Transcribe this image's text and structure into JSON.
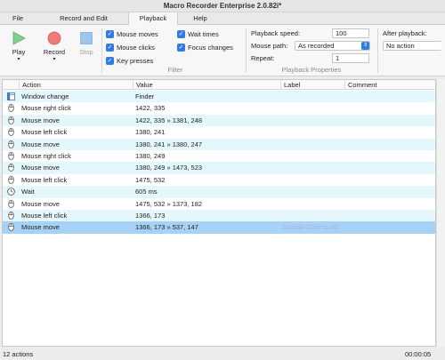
{
  "window": {
    "title": "Macro Recorder Enterprise 2.0.82i*"
  },
  "menu": [
    "File",
    "Record and Edit",
    "Playback",
    "Help"
  ],
  "ribbon": {
    "play": {
      "label": "Play",
      "icon": "play-icon"
    },
    "record": {
      "label": "Record",
      "icon": "record-icon"
    },
    "stop": {
      "label": "Stop",
      "icon": "stop-icon"
    },
    "filter": {
      "group_label": "Filter",
      "mouse_moves": "Mouse moves",
      "mouse_clicks": "Mouse clicks",
      "key_presses": "Key presses",
      "wait_times": "Wait times",
      "focus_changes": "Focus changes"
    },
    "playback_properties": {
      "group_label": "Playback Properties",
      "speed_label": "Playback speed:",
      "speed_value": "100",
      "path_label": "Mouse path:",
      "path_value": "As recorded",
      "repeat_label": "Repeat:",
      "repeat_value": "1"
    },
    "after_playback": {
      "label": "After playback:",
      "value": "No action"
    }
  },
  "table": {
    "columns": [
      "Action",
      "Value",
      "Label",
      "Comment"
    ],
    "rows": [
      {
        "icon": "window-icon",
        "action": "Window change",
        "value": "Finder",
        "label": "",
        "comment": ""
      },
      {
        "icon": "mouse-icon",
        "action": "Mouse right click",
        "value": "1422, 335",
        "label": "",
        "comment": ""
      },
      {
        "icon": "mouse-icon",
        "action": "Mouse move",
        "value": "1422, 335 » 1381, 248",
        "label": "",
        "comment": ""
      },
      {
        "icon": "mouse-icon",
        "action": "Mouse left click",
        "value": "1380, 241",
        "label": "",
        "comment": ""
      },
      {
        "icon": "mouse-icon",
        "action": "Mouse move",
        "value": "1380, 241 » 1380, 247",
        "label": "",
        "comment": ""
      },
      {
        "icon": "mouse-icon",
        "action": "Mouse right click",
        "value": "1380, 249",
        "label": "",
        "comment": ""
      },
      {
        "icon": "mouse-icon",
        "action": "Mouse move",
        "value": "1380, 249 » 1473, 523",
        "label": "",
        "comment": ""
      },
      {
        "icon": "mouse-icon",
        "action": "Mouse left click",
        "value": "1475, 532",
        "label": "",
        "comment": ""
      },
      {
        "icon": "clock-icon",
        "action": "Wait",
        "value": "605 ms",
        "label": "",
        "comment": ""
      },
      {
        "icon": "mouse-icon",
        "action": "Mouse move",
        "value": "1475, 532 » 1373, 182",
        "label": "",
        "comment": ""
      },
      {
        "icon": "mouse-icon",
        "action": "Mouse left click",
        "value": "1366, 173",
        "label": "",
        "comment": ""
      },
      {
        "icon": "mouse-icon",
        "action": "Mouse move",
        "value": "1366, 173 » 537, 147",
        "label": "Double-Click to ad",
        "comment": ""
      }
    ]
  },
  "status": {
    "count": "12 actions",
    "duration": "00:00:05"
  },
  "colors": {
    "accent": "#2f7de1",
    "row_alt": "#e4f7fd",
    "row_selected": "#a7d1f7",
    "play_green": "#7fd08f",
    "record_red": "#f07a7a",
    "stop_blue": "#9ec6ea"
  }
}
